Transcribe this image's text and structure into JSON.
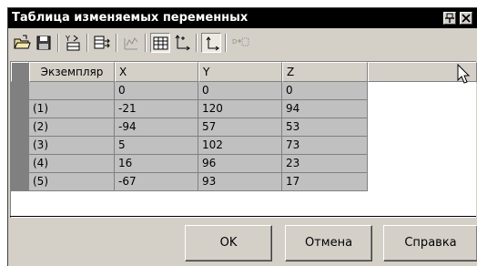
{
  "window": {
    "title": "Таблица изменяемых переменных"
  },
  "titlebar_buttons": {
    "pin": "ᵖ",
    "close": "×"
  },
  "toolbar": {
    "icons": [
      "open-icon",
      "save-icon",
      "transpose-icon",
      "import-icon",
      "graph-icon",
      "table-view-icon",
      "axes-icon",
      "coordinate-icon",
      "dimension-icon"
    ]
  },
  "table": {
    "columns": [
      "Экземпляр",
      "X",
      "Y",
      "Z",
      ""
    ],
    "rows": [
      {
        "instance": "",
        "x": "0",
        "y": "0",
        "z": "0"
      },
      {
        "instance": "(1)",
        "x": "-21",
        "y": "120",
        "z": "94"
      },
      {
        "instance": "(2)",
        "x": "-94",
        "y": "57",
        "z": "53"
      },
      {
        "instance": "(3)",
        "x": "5",
        "y": "102",
        "z": "73"
      },
      {
        "instance": "(4)",
        "x": "16",
        "y": "96",
        "z": "23"
      },
      {
        "instance": "(5)",
        "x": "-67",
        "y": "93",
        "z": "17"
      }
    ]
  },
  "buttons": {
    "ok": "OK",
    "cancel": "Отмена",
    "help": "Справка"
  }
}
